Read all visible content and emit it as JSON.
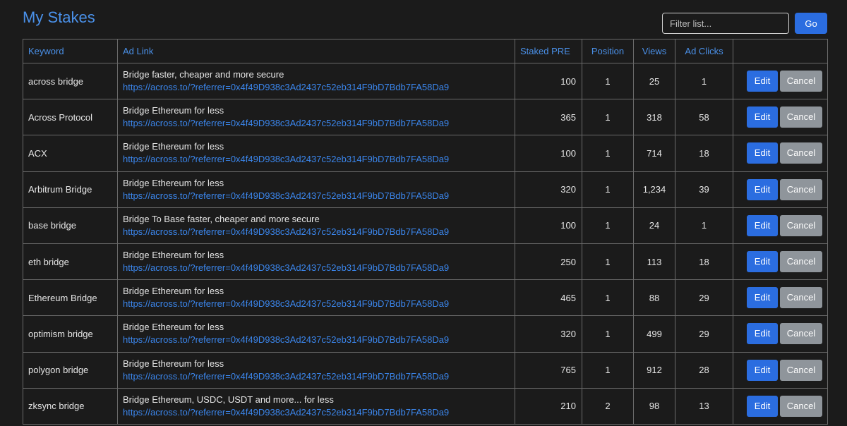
{
  "header": {
    "title": "My Stakes"
  },
  "filter": {
    "placeholder": "Filter list...",
    "go_label": "Go"
  },
  "table": {
    "columns": [
      "Keyword",
      "Ad Link",
      "Staked PRE",
      "Position",
      "Views",
      "Ad Clicks",
      ""
    ],
    "rows": [
      {
        "keyword": "across bridge",
        "ad_title": "Bridge faster, cheaper and more secure",
        "ad_url": "https://across.to/?referrer=0x4f49D938c3Ad2437c52eb314F9bD7Bdb7FA58Da9",
        "staked": "100",
        "position": "1",
        "views": "25",
        "clicks": "1",
        "edit": "Edit",
        "cancel": "Cancel"
      },
      {
        "keyword": "Across Protocol",
        "ad_title": "Bridge Ethereum for less",
        "ad_url": "https://across.to/?referrer=0x4f49D938c3Ad2437c52eb314F9bD7Bdb7FA58Da9",
        "staked": "365",
        "position": "1",
        "views": "318",
        "clicks": "58",
        "edit": "Edit",
        "cancel": "Cancel"
      },
      {
        "keyword": "ACX",
        "ad_title": "Bridge Ethereum for less",
        "ad_url": "https://across.to/?referrer=0x4f49D938c3Ad2437c52eb314F9bD7Bdb7FA58Da9",
        "staked": "100",
        "position": "1",
        "views": "714",
        "clicks": "18",
        "edit": "Edit",
        "cancel": "Cancel"
      },
      {
        "keyword": "Arbitrum Bridge",
        "ad_title": "Bridge Ethereum for less",
        "ad_url": "https://across.to/?referrer=0x4f49D938c3Ad2437c52eb314F9bD7Bdb7FA58Da9",
        "staked": "320",
        "position": "1",
        "views": "1,234",
        "clicks": "39",
        "edit": "Edit",
        "cancel": "Cancel"
      },
      {
        "keyword": "base bridge",
        "ad_title": "Bridge To Base faster, cheaper and more secure",
        "ad_url": "https://across.to/?referrer=0x4f49D938c3Ad2437c52eb314F9bD7Bdb7FA58Da9",
        "staked": "100",
        "position": "1",
        "views": "24",
        "clicks": "1",
        "edit": "Edit",
        "cancel": "Cancel"
      },
      {
        "keyword": "eth bridge",
        "ad_title": "Bridge Ethereum for less",
        "ad_url": "https://across.to/?referrer=0x4f49D938c3Ad2437c52eb314F9bD7Bdb7FA58Da9",
        "staked": "250",
        "position": "1",
        "views": "113",
        "clicks": "18",
        "edit": "Edit",
        "cancel": "Cancel"
      },
      {
        "keyword": "Ethereum Bridge",
        "ad_title": "Bridge Ethereum for less",
        "ad_url": "https://across.to/?referrer=0x4f49D938c3Ad2437c52eb314F9bD7Bdb7FA58Da9",
        "staked": "465",
        "position": "1",
        "views": "88",
        "clicks": "29",
        "edit": "Edit",
        "cancel": "Cancel"
      },
      {
        "keyword": "optimism bridge",
        "ad_title": "Bridge Ethereum for less",
        "ad_url": "https://across.to/?referrer=0x4f49D938c3Ad2437c52eb314F9bD7Bdb7FA58Da9",
        "staked": "320",
        "position": "1",
        "views": "499",
        "clicks": "29",
        "edit": "Edit",
        "cancel": "Cancel"
      },
      {
        "keyword": "polygon bridge",
        "ad_title": "Bridge Ethereum for less",
        "ad_url": "https://across.to/?referrer=0x4f49D938c3Ad2437c52eb314F9bD7Bdb7FA58Da9",
        "staked": "765",
        "position": "1",
        "views": "912",
        "clicks": "28",
        "edit": "Edit",
        "cancel": "Cancel"
      },
      {
        "keyword": "zksync bridge",
        "ad_title": "Bridge Ethereum, USDC, USDT and more... for less",
        "ad_url": "https://across.to/?referrer=0x4f49D938c3Ad2437c52eb314F9bD7Bdb7FA58Da9",
        "staked": "210",
        "position": "2",
        "views": "98",
        "clicks": "13",
        "edit": "Edit",
        "cancel": "Cancel"
      }
    ]
  },
  "colors": {
    "background": "#1b1b1b",
    "accent": "#4a90e8",
    "link": "#3b86ec",
    "primary_button": "#2b6de0",
    "secondary_button": "#8f959b",
    "border": "#6a6a6a"
  }
}
